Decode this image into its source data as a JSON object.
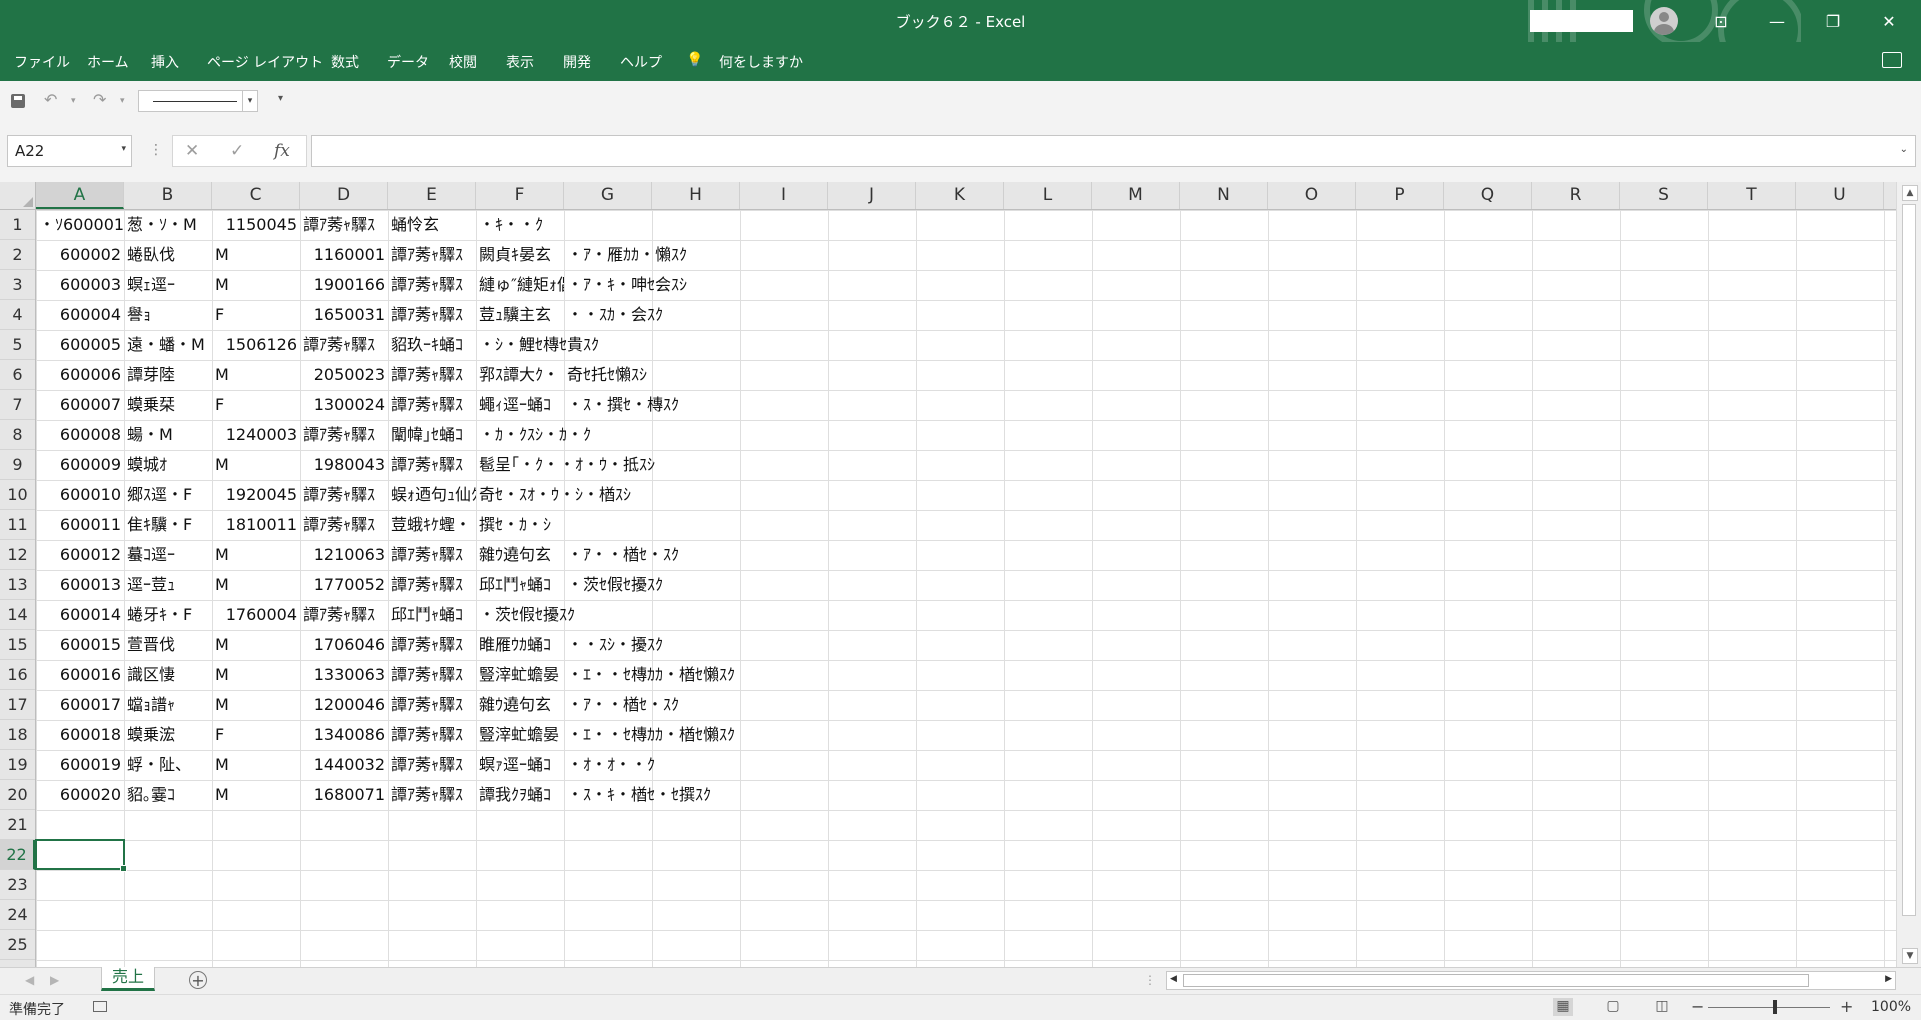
{
  "window": {
    "title": "ブック６２  -  Excel",
    "colors": {
      "brand": "#217346"
    }
  },
  "menu": {
    "tabs": [
      "ファイル",
      "ホーム",
      "挿入",
      "ページ レイアウト",
      "数式",
      "データ",
      "校閲",
      "表示",
      "開発",
      "ヘルプ"
    ],
    "tell_me": "何をしますか"
  },
  "formula_bar": {
    "name_box": "A22",
    "fx_label": "fx",
    "cancel_symbol": "✕",
    "enter_symbol": "✓",
    "formula": ""
  },
  "grid": {
    "columns": [
      "A",
      "B",
      "C",
      "D",
      "E",
      "F",
      "G",
      "H",
      "I",
      "J",
      "K",
      "L",
      "M",
      "N",
      "O",
      "P",
      "Q",
      "R",
      "S",
      "T",
      "U"
    ],
    "rows": [
      "1",
      "2",
      "3",
      "4",
      "5",
      "6",
      "7",
      "8",
      "9",
      "10",
      "11",
      "12",
      "13",
      "14",
      "15",
      "16",
      "17",
      "18",
      "19",
      "20",
      "21",
      "22",
      "23",
      "24",
      "25"
    ],
    "selected_cell": "A22",
    "data_rows": [
      {
        "A": "・ｿ600001",
        "B": "葱・ｿ・M",
        "C": "1150045",
        "D": "譚ｱ莠ｬ驛ｽ",
        "E": "蛹怜玄",
        "F": "・ｷ・・ｸ",
        "G": ""
      },
      {
        "A": "600002",
        "B": "蜷臥伐",
        "C": "M",
        "D": "1160001",
        "E": "譚ｱ莠ｬ驛ｽ",
        "F": "闕貞ｷ晏玄",
        "G": "・ｱ・雁ｶｶ・懶ｽｸ"
      },
      {
        "A": "600003",
        "B": "螟ｪ逕ｰ",
        "C": "M",
        "D": "1900166",
        "E": "譚ｱ莠ｬ驛ｽ",
        "F": "縺ゅ″縺矩ｫ倡",
        "G": "・ｱ・ｷ・呻ｾ会ｽｼ"
      },
      {
        "A": "600004",
        "B": "譽ｮ",
        "C": "F",
        "D": "1650031",
        "E": "譚ｱ莠ｬ驛ｽ",
        "F": "荳ｭ驥主玄",
        "G": "・・ｽｶ・会ｽｸ"
      },
      {
        "A": "600005",
        "B": "遠・蟠・M",
        "C": "1506126",
        "D": "譚ｱ莠ｬ驛ｽ",
        "E": "貂玖ｰｷ蛹ｺ",
        "F": "・ｼ・鯉ｾ槫ｾ貴ｽｸ",
        "G": ""
      },
      {
        "A": "600006",
        "B": "譚芽陸",
        "C": "M",
        "D": "2050023",
        "E": "譚ｱ莠ｬ驛ｽ",
        "F": "郛ｽ譚大ｸ・・",
        "G": "奇ｾ托ｾ懶ｽｼ"
      },
      {
        "A": "600007",
        "B": "蟆乗栞",
        "C": "F",
        "D": "1300024",
        "E": "譚ｱ莠ｬ驛ｽ",
        "F": "蠅ｨ逕ｰ蛹ｺ",
        "G": "・ｽ・撰ｾ・槫ｽｸ"
      },
      {
        "A": "600008",
        "B": "蝪・M",
        "C": "1240003",
        "D": "譚ｱ莠ｬ驛ｽ",
        "E": "闡幃｣ｾ蛹ｺ",
        "F": "・ｶ・ｸｽｼ・ｶ・ｸ",
        "G": ""
      },
      {
        "A": "600009",
        "B": "蟆城ｵ",
        "C": "M",
        "D": "1980043",
        "E": "譚ｱ莠ｬ驛ｽ",
        "F": "髱呈｢・ｸ・・ｵ・ｳ・抵ｽｼ",
        "G": ""
      },
      {
        "A": "600010",
        "B": "郷ｽ逕・F",
        "C": "1920045",
        "D": "譚ｱ莠ｬ驛ｽ",
        "E": "蜈ｫ迺句ｭ仙ｸ・・",
        "F": "奇ｾ・ｽｵ・ｳ・ｼ・楢ｽｼ",
        "G": ""
      },
      {
        "A": "600011",
        "B": "隹ｷ驥・F",
        "C": "1810011",
        "D": "譚ｱ莠ｬ驛ｽ",
        "E": "荳蛾ｷｹ蟶・・",
        "F": "撰ｾ・ｶ・ｼ",
        "G": ""
      },
      {
        "A": "600012",
        "B": "蟇ｺ逕ｰ",
        "C": "M",
        "D": "1210063",
        "E": "譚ｱ莠ｬ驛ｽ",
        "F": "雜ｳ遶句玄",
        "G": "・ｱ・・楢ｾ・ｽｸ"
      },
      {
        "A": "600013",
        "B": "逕ｰ荳ｭ",
        "C": "M",
        "D": "1770052",
        "E": "譚ｱ莠ｬ驛ｽ",
        "F": "邱ｴ鬥ｬ蛹ｺ",
        "G": "・茨ｾ假ｾ擾ｽｸ"
      },
      {
        "A": "600014",
        "B": "蜷牙ｷ・F",
        "C": "1760004",
        "D": "譚ｱ莠ｬ驛ｽ",
        "E": "邱ｴ鬥ｬ蛹ｺ",
        "F": "・茨ｾ假ｾ擾ｽｸ",
        "G": ""
      },
      {
        "A": "600015",
        "B": "萱晋伐",
        "C": "M",
        "D": "1706046",
        "E": "譚ｱ莠ｬ驛ｽ",
        "F": "睢雁ｳｶ蛹ｺ",
        "G": "・・ｽｼ・擾ｽｸ"
      },
      {
        "A": "600016",
        "B": "識区悽",
        "C": "M",
        "D": "1330063",
        "E": "譚ｱ莠ｬ驛ｽ",
        "F": "豎滓虻蟾晏",
        "G": "・ｴ・・ｾ槫ｶｶ・楢ｾ懶ｽｸ"
      },
      {
        "A": "600017",
        "B": "蟷ｮ譜ｬ",
        "C": "M",
        "D": "1200046",
        "E": "譚ｱ莠ｬ驛ｽ",
        "F": "雜ｳ遶句玄",
        "G": "・ｱ・・楢ｾ・ｽｸ"
      },
      {
        "A": "600018",
        "B": "蟆乗浤",
        "C": "F",
        "D": "1340086",
        "E": "譚ｱ莠ｬ驛ｽ",
        "F": "豎滓虻蟾晏",
        "G": "・ｴ・・ｾ槫ｶｶ・楢ｾ懶ｽｸ"
      },
      {
        "A": "600019",
        "B": "蜉・阯、",
        "C": "M",
        "D": "1440032",
        "E": "譚ｱ莠ｬ驛ｽ",
        "F": "螟ｧ逕ｰ蛹ｺ",
        "G": "・ｵ・ｵ・・ｸ"
      },
      {
        "A": "600020",
        "B": "貂｡霎ｺ",
        "C": "M",
        "D": "1680071",
        "E": "譚ｱ莠ｬ驛ｽ",
        "F": "譚我ｸｦ蛹ｺ",
        "G": "・ｽ・ｷ・楢ｾ・ｾ撰ｽｸ"
      }
    ]
  },
  "sheet_tabs": [
    "売上"
  ],
  "status": {
    "ready": "準備完了",
    "zoom": "100%"
  }
}
